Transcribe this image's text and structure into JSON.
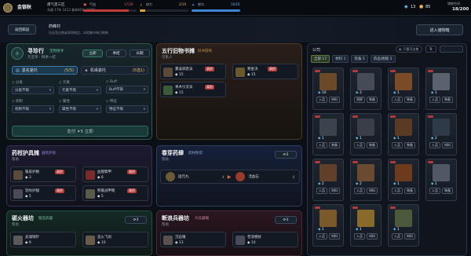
{
  "topbar": {
    "player_name": "金银秋",
    "region": "南气黑三区",
    "date": "东顺 17年 1413 春有82年 (1/26)",
    "hp": "17/20",
    "stamina": "2/19",
    "exp": "16/16",
    "hp_label": "气血",
    "stamina_label": "体力",
    "exp_label": "修为",
    "hp_pct": 0.85,
    "stamina_pct": 0.11,
    "exp_pct": 1.0,
    "currency_a": "13",
    "currency_b": "85",
    "bag_label": "储物空间",
    "bag_value": "18/200"
  },
  "subbar": {
    "back_label": "返回家园",
    "location": "药峰村",
    "hint": "在这里出售或采购物品，本地集市每日刷新",
    "enter_label": "进入储物箱"
  },
  "xunzhen": {
    "title": "寻珍行",
    "tag": "宝物搜寻",
    "subtitle": "元宝单 · 每季一结",
    "tab_current": "立即",
    "tab_week": "季结",
    "tab_long": "长期",
    "mode_a": "墨名委托",
    "mode_a_count": "(5/5)",
    "mode_b": "机缘委托",
    "mode_b_count": "(5选1)",
    "filters": [
      {
        "label": "分类",
        "value": "分类不限"
      },
      {
        "label": "元素",
        "value": "元素不限"
      },
      {
        "label": "Buff",
        "value": "Buff不限"
      },
      {
        "label": "机制",
        "value": "机制不限"
      },
      {
        "label": "属性",
        "value": "属性不限"
      },
      {
        "label": "特征",
        "value": "特征不限"
      }
    ],
    "pay_label": "支付 ✦5 立即"
  },
  "wuxing": {
    "title": "五行旧物书摊",
    "tag": "旧书游商",
    "subtitle": "可售人",
    "items": [
      {
        "name": "雾凌调息诀",
        "count": "15",
        "badge": "高阶"
      },
      {
        "name": "青木引灵诀",
        "count": "15",
        "badge": "高阶"
      }
    ],
    "side_item": {
      "name": "寒金决",
      "count": "15",
      "badge": "高阶"
    }
  },
  "yaoxian": {
    "title": "药柑护具摊",
    "tag": "器装护具",
    "subtitle": "帮助",
    "items": [
      {
        "name": "狼皮护腕",
        "count": "3",
        "badge": "高阶"
      },
      {
        "name": "血猩臂甲",
        "count": "6",
        "badge": "高阶"
      },
      {
        "name": "羽纹护腿",
        "count": "5",
        "badge": "高阶"
      },
      {
        "name": "熊骸战甲靴",
        "count": "5",
        "badge": "高阶"
      }
    ]
  },
  "chunhan": {
    "title": "春芽药肆",
    "tag": "药材杂货",
    "subtitle": "帮助",
    "refresh": "3",
    "items": [
      {
        "name": "固元丸",
        "count": "4"
      },
      {
        "name": "活血石",
        "count": "4"
      }
    ]
  },
  "jiehuo": {
    "title": "砺火器坊",
    "tag": "锻造武器",
    "subtitle": "帮会",
    "refresh": "3",
    "items": [
      {
        "name": "炙魂铜针",
        "count": "9"
      },
      {
        "name": "追火飞剑",
        "count": "10"
      }
    ]
  },
  "duanlang": {
    "title": "断浪兵器坊",
    "tag": "冷兵器铺",
    "subtitle": "帮助",
    "refresh": "3",
    "items": [
      {
        "name": "沉岳锤",
        "count": "13"
      },
      {
        "name": "苍浪棍杖",
        "count": "10"
      }
    ]
  },
  "storage": {
    "title": "公司",
    "toggle_label": "只看可出售",
    "tabs": [
      "全部 17",
      "材料 1",
      "装备 5",
      "药品/图纸 5"
    ],
    "cards": [
      {
        "count": "10",
        "tags": [
          "入品",
          "材料"
        ],
        "color": "#6b4a2a"
      },
      {
        "count": "3",
        "tags": [
          "洞察",
          "装备"
        ],
        "color": "#454c58"
      },
      {
        "count": "1",
        "tags": [
          "入品",
          "装备"
        ],
        "color": "#7a4b26"
      },
      {
        "count": "1",
        "tags": [
          "入品",
          "装备"
        ],
        "color": "#5a6270"
      },
      {
        "count": "1",
        "tags": [
          "入品",
          "装备"
        ],
        "color": "#3d434c"
      },
      {
        "count": "1",
        "tags": [
          "入品",
          "装备"
        ],
        "color": "#3a3f47"
      },
      {
        "count": "1",
        "tags": [
          "入品",
          "装备"
        ],
        "color": "#5a3a22"
      },
      {
        "count": "2",
        "tags": [
          "入品",
          "材料"
        ],
        "color": "#2e3a48"
      },
      {
        "count": "2",
        "tags": [
          "入品",
          "材料"
        ],
        "color": "#60402a"
      },
      {
        "count": "2",
        "tags": [
          "入品",
          "材料"
        ],
        "color": "#6a4a30"
      },
      {
        "count": "1",
        "tags": [
          "入品",
          "装备"
        ],
        "color": "#6e3a1e"
      },
      {
        "count": "1",
        "tags": [
          "入品",
          "装备"
        ],
        "color": "#505866"
      },
      {
        "count": "1",
        "tags": [
          "入品",
          "材料"
        ],
        "color": "#7a5a2a"
      },
      {
        "count": "1",
        "tags": [
          "入品",
          "材料"
        ],
        "color": "#8a6a2a"
      },
      {
        "count": "1",
        "tags": [
          "入品",
          "材料"
        ],
        "color": "#4a5a3a"
      }
    ]
  }
}
